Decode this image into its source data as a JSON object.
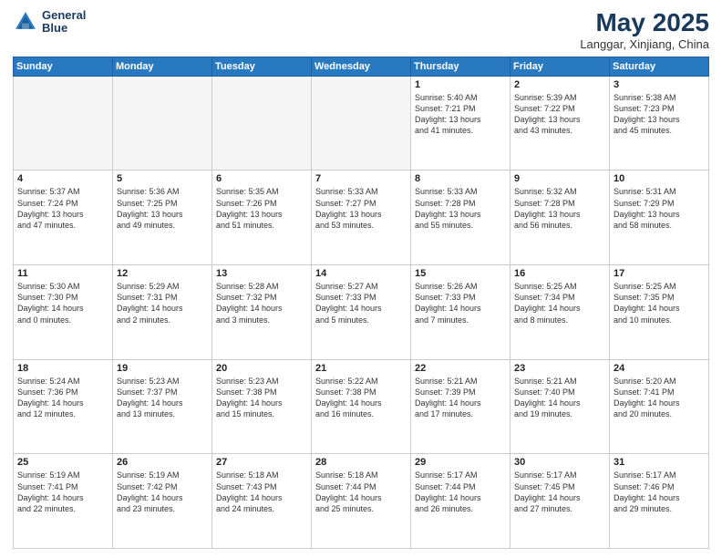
{
  "header": {
    "logo_line1": "General",
    "logo_line2": "Blue",
    "title": "May 2025",
    "subtitle": "Langgar, Xinjiang, China"
  },
  "weekdays": [
    "Sunday",
    "Monday",
    "Tuesday",
    "Wednesday",
    "Thursday",
    "Friday",
    "Saturday"
  ],
  "weeks": [
    [
      {
        "day": "",
        "detail": ""
      },
      {
        "day": "",
        "detail": ""
      },
      {
        "day": "",
        "detail": ""
      },
      {
        "day": "",
        "detail": ""
      },
      {
        "day": "1",
        "detail": "Sunrise: 5:40 AM\nSunset: 7:21 PM\nDaylight: 13 hours\nand 41 minutes."
      },
      {
        "day": "2",
        "detail": "Sunrise: 5:39 AM\nSunset: 7:22 PM\nDaylight: 13 hours\nand 43 minutes."
      },
      {
        "day": "3",
        "detail": "Sunrise: 5:38 AM\nSunset: 7:23 PM\nDaylight: 13 hours\nand 45 minutes."
      }
    ],
    [
      {
        "day": "4",
        "detail": "Sunrise: 5:37 AM\nSunset: 7:24 PM\nDaylight: 13 hours\nand 47 minutes."
      },
      {
        "day": "5",
        "detail": "Sunrise: 5:36 AM\nSunset: 7:25 PM\nDaylight: 13 hours\nand 49 minutes."
      },
      {
        "day": "6",
        "detail": "Sunrise: 5:35 AM\nSunset: 7:26 PM\nDaylight: 13 hours\nand 51 minutes."
      },
      {
        "day": "7",
        "detail": "Sunrise: 5:33 AM\nSunset: 7:27 PM\nDaylight: 13 hours\nand 53 minutes."
      },
      {
        "day": "8",
        "detail": "Sunrise: 5:33 AM\nSunset: 7:28 PM\nDaylight: 13 hours\nand 55 minutes."
      },
      {
        "day": "9",
        "detail": "Sunrise: 5:32 AM\nSunset: 7:28 PM\nDaylight: 13 hours\nand 56 minutes."
      },
      {
        "day": "10",
        "detail": "Sunrise: 5:31 AM\nSunset: 7:29 PM\nDaylight: 13 hours\nand 58 minutes."
      }
    ],
    [
      {
        "day": "11",
        "detail": "Sunrise: 5:30 AM\nSunset: 7:30 PM\nDaylight: 14 hours\nand 0 minutes."
      },
      {
        "day": "12",
        "detail": "Sunrise: 5:29 AM\nSunset: 7:31 PM\nDaylight: 14 hours\nand 2 minutes."
      },
      {
        "day": "13",
        "detail": "Sunrise: 5:28 AM\nSunset: 7:32 PM\nDaylight: 14 hours\nand 3 minutes."
      },
      {
        "day": "14",
        "detail": "Sunrise: 5:27 AM\nSunset: 7:33 PM\nDaylight: 14 hours\nand 5 minutes."
      },
      {
        "day": "15",
        "detail": "Sunrise: 5:26 AM\nSunset: 7:33 PM\nDaylight: 14 hours\nand 7 minutes."
      },
      {
        "day": "16",
        "detail": "Sunrise: 5:25 AM\nSunset: 7:34 PM\nDaylight: 14 hours\nand 8 minutes."
      },
      {
        "day": "17",
        "detail": "Sunrise: 5:25 AM\nSunset: 7:35 PM\nDaylight: 14 hours\nand 10 minutes."
      }
    ],
    [
      {
        "day": "18",
        "detail": "Sunrise: 5:24 AM\nSunset: 7:36 PM\nDaylight: 14 hours\nand 12 minutes."
      },
      {
        "day": "19",
        "detail": "Sunrise: 5:23 AM\nSunset: 7:37 PM\nDaylight: 14 hours\nand 13 minutes."
      },
      {
        "day": "20",
        "detail": "Sunrise: 5:23 AM\nSunset: 7:38 PM\nDaylight: 14 hours\nand 15 minutes."
      },
      {
        "day": "21",
        "detail": "Sunrise: 5:22 AM\nSunset: 7:38 PM\nDaylight: 14 hours\nand 16 minutes."
      },
      {
        "day": "22",
        "detail": "Sunrise: 5:21 AM\nSunset: 7:39 PM\nDaylight: 14 hours\nand 17 minutes."
      },
      {
        "day": "23",
        "detail": "Sunrise: 5:21 AM\nSunset: 7:40 PM\nDaylight: 14 hours\nand 19 minutes."
      },
      {
        "day": "24",
        "detail": "Sunrise: 5:20 AM\nSunset: 7:41 PM\nDaylight: 14 hours\nand 20 minutes."
      }
    ],
    [
      {
        "day": "25",
        "detail": "Sunrise: 5:19 AM\nSunset: 7:41 PM\nDaylight: 14 hours\nand 22 minutes."
      },
      {
        "day": "26",
        "detail": "Sunrise: 5:19 AM\nSunset: 7:42 PM\nDaylight: 14 hours\nand 23 minutes."
      },
      {
        "day": "27",
        "detail": "Sunrise: 5:18 AM\nSunset: 7:43 PM\nDaylight: 14 hours\nand 24 minutes."
      },
      {
        "day": "28",
        "detail": "Sunrise: 5:18 AM\nSunset: 7:44 PM\nDaylight: 14 hours\nand 25 minutes."
      },
      {
        "day": "29",
        "detail": "Sunrise: 5:17 AM\nSunset: 7:44 PM\nDaylight: 14 hours\nand 26 minutes."
      },
      {
        "day": "30",
        "detail": "Sunrise: 5:17 AM\nSunset: 7:45 PM\nDaylight: 14 hours\nand 27 minutes."
      },
      {
        "day": "31",
        "detail": "Sunrise: 5:17 AM\nSunset: 7:46 PM\nDaylight: 14 hours\nand 29 minutes."
      }
    ]
  ]
}
